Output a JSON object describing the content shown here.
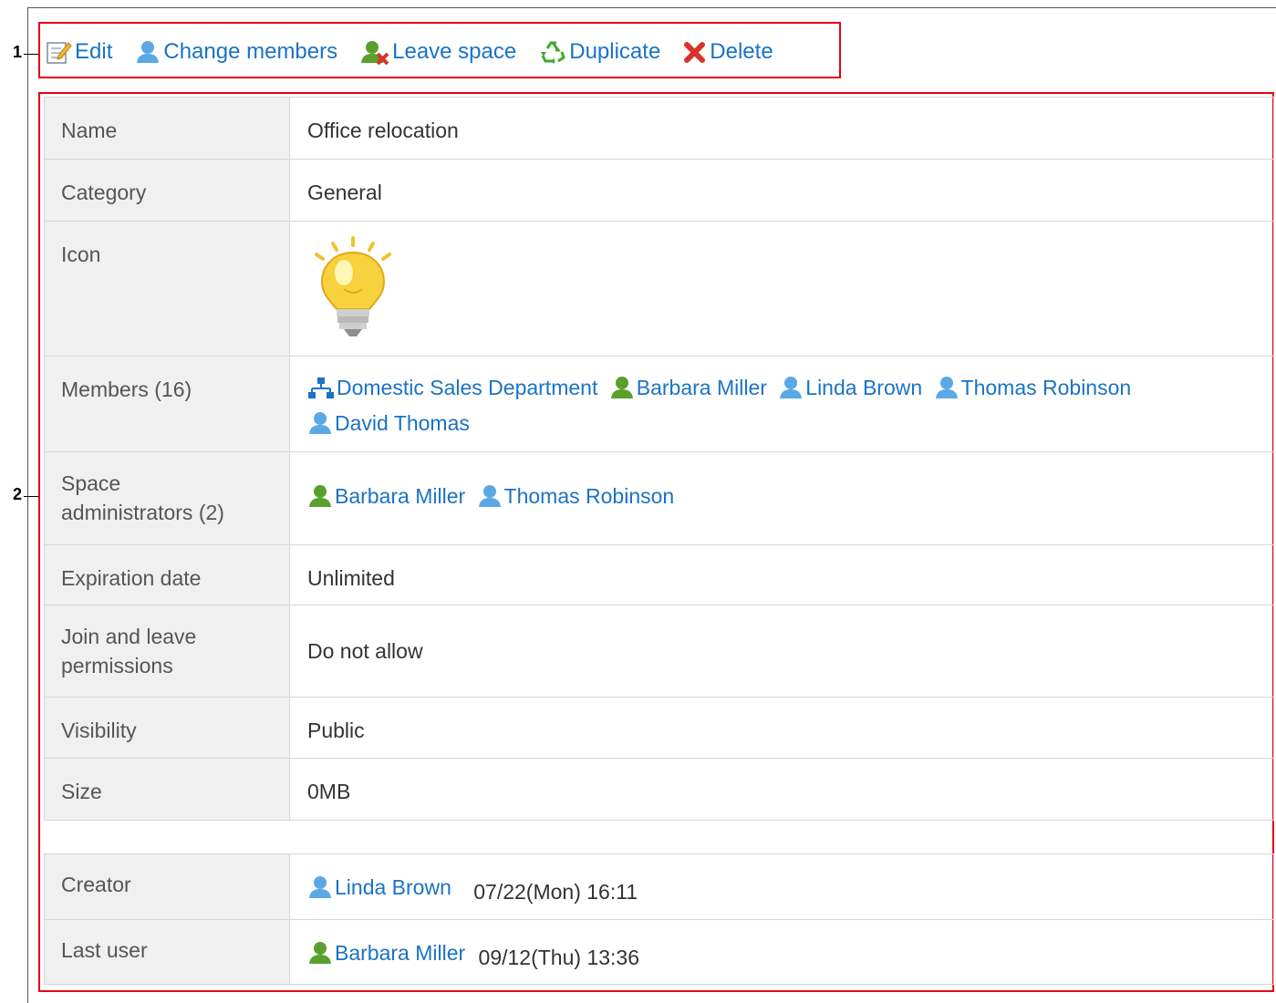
{
  "callouts": [
    "1",
    "2"
  ],
  "toolbar": {
    "edit": "Edit",
    "change_members": "Change members",
    "leave_space": "Leave space",
    "duplicate": "Duplicate",
    "delete": "Delete"
  },
  "details": {
    "name": {
      "label": "Name",
      "value": "Office relocation"
    },
    "category": {
      "label": "Category",
      "value": "General"
    },
    "icon": {
      "label": "Icon",
      "value_icon": "lightbulb-icon"
    },
    "members": {
      "label": "Members (16)",
      "items": [
        {
          "name": "Domestic Sales Department",
          "type": "organization"
        },
        {
          "name": "Barbara Miller",
          "type": "user-green"
        },
        {
          "name": "Linda Brown",
          "type": "user-blue"
        },
        {
          "name": "Thomas Robinson",
          "type": "user-blue"
        },
        {
          "name": "David Thomas",
          "type": "user-blue"
        }
      ]
    },
    "administrators": {
      "label_line1": "Space",
      "label_line2": "administrators (2)",
      "items": [
        {
          "name": "Barbara Miller",
          "type": "user-green"
        },
        {
          "name": "Thomas Robinson",
          "type": "user-blue"
        }
      ]
    },
    "expiration": {
      "label": "Expiration date",
      "value": "Unlimited"
    },
    "join_leave": {
      "label_line1": "Join and leave",
      "label_line2": "permissions",
      "value": "Do not allow"
    },
    "visibility": {
      "label": "Visibility",
      "value": "Public"
    },
    "size": {
      "label": "Size",
      "value": "0MB"
    }
  },
  "history": {
    "creator": {
      "label": "Creator",
      "user": "Linda Brown",
      "timestamp": "07/22(Mon) 16:11"
    },
    "last_user": {
      "label": "Last user",
      "user": "Barbara Miller",
      "timestamp": "09/12(Thu) 13:36"
    }
  },
  "colors": {
    "link": "#1a73c4",
    "callout_box": "#e60012",
    "label_bg": "#f0f0f0",
    "user_blue": "#5aa9e6",
    "user_green": "#5aa02c"
  }
}
